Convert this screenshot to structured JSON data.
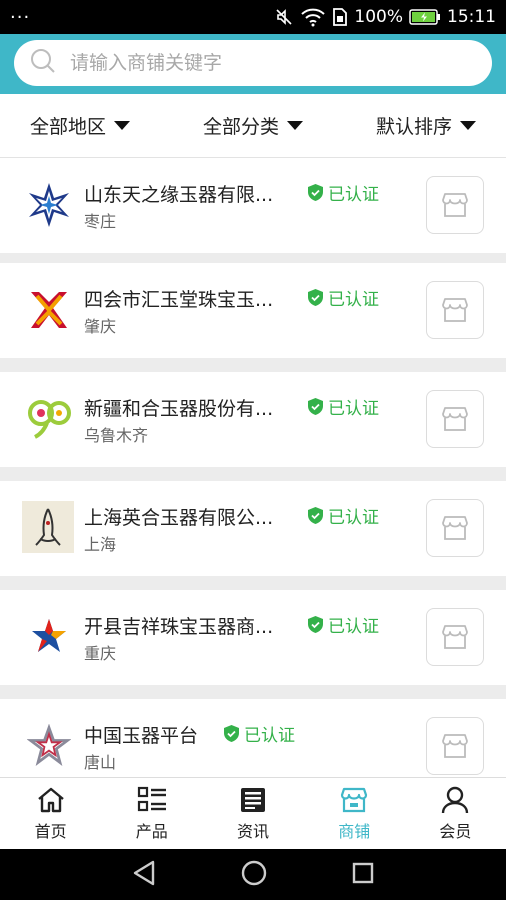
{
  "status_bar": {
    "dots": "···",
    "battery": "100%",
    "time": "15:11"
  },
  "search": {
    "placeholder": "请输入商铺关键字"
  },
  "filters": [
    {
      "label": "全部地区"
    },
    {
      "label": "全部分类"
    },
    {
      "label": "默认排序"
    }
  ],
  "cert_label": "已认证",
  "shops": [
    {
      "name": "山东天之缘玉器有限...",
      "city": "枣庄",
      "logo": "compass-star-logo"
    },
    {
      "name": "四会市汇玉堂珠宝玉...",
      "city": "肇庆",
      "logo": "x-mark-logo"
    },
    {
      "name": "新疆和合玉器股份有...",
      "city": "乌鲁木齐",
      "logo": "ring-logo"
    },
    {
      "name": "上海英合玉器有限公...",
      "city": "上海",
      "logo": "figure-logo"
    },
    {
      "name": "开县吉祥珠宝玉器商...",
      "city": "重庆",
      "logo": "star-figure-logo"
    },
    {
      "name": "中国玉器平台",
      "city": "唐山",
      "logo": "outline-star-logo"
    }
  ],
  "tabs": [
    {
      "label": "首页",
      "icon": "home-icon"
    },
    {
      "label": "产品",
      "icon": "list-icon"
    },
    {
      "label": "资讯",
      "icon": "news-icon"
    },
    {
      "label": "商铺",
      "icon": "store-icon",
      "active": true
    },
    {
      "label": "会员",
      "icon": "user-icon"
    }
  ],
  "colors": {
    "accent": "#3fb7c8",
    "cert_green": "#34b14a"
  }
}
